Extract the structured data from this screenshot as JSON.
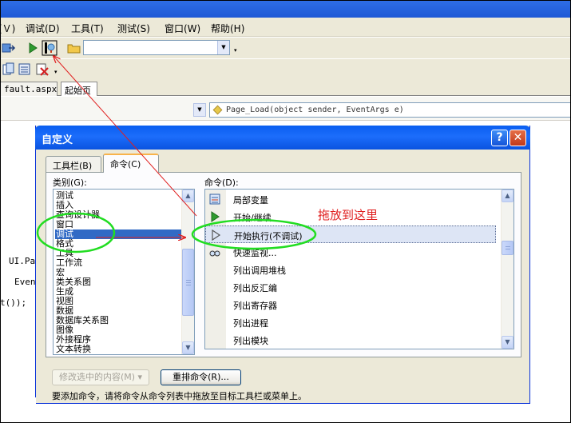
{
  "menubar": {
    "items": [
      {
        "label": "(Ｖ)"
      },
      {
        "label": "调试(D)"
      },
      {
        "label": "工具(T)"
      },
      {
        "label": "测试(S)"
      },
      {
        "label": "窗口(W)"
      },
      {
        "label": "帮助(H)"
      }
    ]
  },
  "document_tabs": [
    "fault.aspx",
    "起始页"
  ],
  "editor": {
    "method_combo": "Page_Load(object sender, EventArgs e)",
    "code_fragments": [
      "UI.Pa",
      "Event",
      "t());"
    ]
  },
  "dialog": {
    "title": "自定义",
    "help_glyph": "?",
    "close_glyph": "✕",
    "tabs": [
      {
        "label": "工具栏(B)",
        "active": false
      },
      {
        "label": "命令(C)",
        "active": true
      }
    ],
    "categories_label": "类别(G):",
    "categories": [
      "测试",
      "插入",
      "查询设计器",
      "窗口",
      "调试",
      "格式",
      "工具",
      "工作流",
      "宏",
      "类关系图",
      "生成",
      "视图",
      "数据",
      "数据库关系图",
      "图像",
      "外接程序",
      "文本转换"
    ],
    "selected_category": "调试",
    "commands_label": "命令(D):",
    "commands": [
      {
        "label": "局部变量",
        "icon": "locals-icon"
      },
      {
        "label": "开始/继续",
        "icon": "play-icon"
      },
      {
        "label": "开始执行(不调试)",
        "icon": "play-outline-icon",
        "selected": true
      },
      {
        "label": "快速监视...",
        "icon": "glasses-icon"
      },
      {
        "label": "列出调用堆栈",
        "icon": ""
      },
      {
        "label": "列出反汇编",
        "icon": ""
      },
      {
        "label": "列出寄存器",
        "icon": ""
      },
      {
        "label": "列出进程",
        "icon": ""
      },
      {
        "label": "列出模块",
        "icon": ""
      }
    ],
    "modify_button": "修改选中的内容(M) ▾",
    "rearrange_button": "重排命令(R)...",
    "instructions": "要添加命令，请将命令从命令列表中拖放至目标工具栏或菜单上。"
  },
  "annotation": {
    "text": "拖放到这里",
    "color": "#e02020"
  },
  "colors": {
    "titlebar": "#0a5ef0",
    "selection": "#316ac5",
    "highlight_ellipse": "#22dd22",
    "arrow": "#e02020"
  }
}
